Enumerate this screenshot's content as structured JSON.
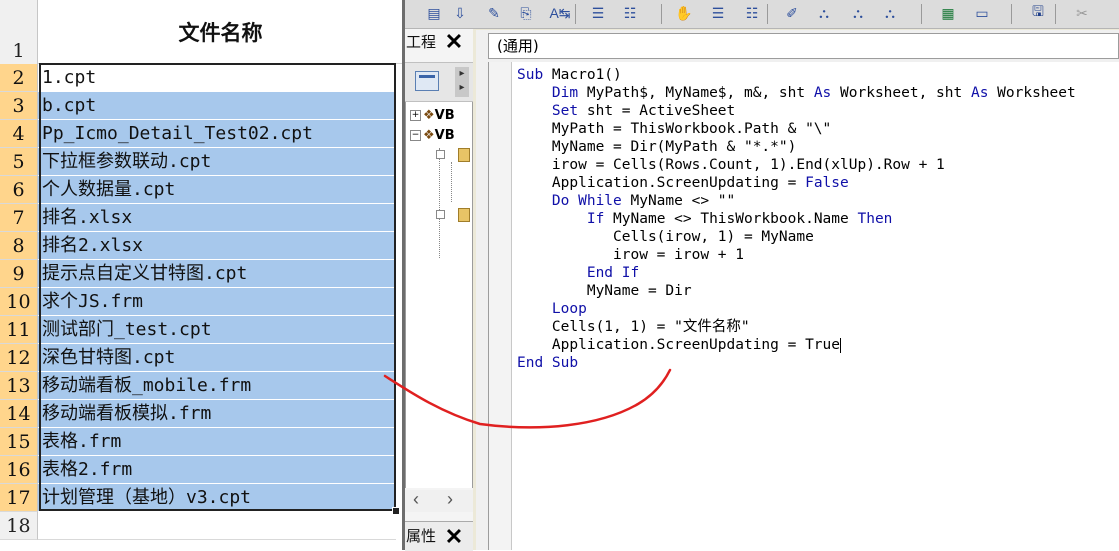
{
  "excel": {
    "header_row_number": "1",
    "header": "文件名称",
    "rows": [
      {
        "num": "2",
        "value": "1.cpt"
      },
      {
        "num": "3",
        "value": "b.cpt"
      },
      {
        "num": "4",
        "value": "Pp_Icmo_Detail_Test02.cpt"
      },
      {
        "num": "5",
        "value": "下拉框参数联动.cpt"
      },
      {
        "num": "6",
        "value": "个人数据量.cpt"
      },
      {
        "num": "7",
        "value": "排名.xlsx"
      },
      {
        "num": "8",
        "value": "排名2.xlsx"
      },
      {
        "num": "9",
        "value": "提示点自定义甘特图.cpt"
      },
      {
        "num": "10",
        "value": "求个JS.frm"
      },
      {
        "num": "11",
        "value": "测试部门_test.cpt"
      },
      {
        "num": "12",
        "value": "深色甘特图.cpt"
      },
      {
        "num": "13",
        "value": "移动端看板_mobile.frm"
      },
      {
        "num": "14",
        "value": "移动端看板模拟.frm"
      },
      {
        "num": "15",
        "value": "表格.frm"
      },
      {
        "num": "16",
        "value": "表格2.frm"
      },
      {
        "num": "17",
        "value": "计划管理（基地）v3.cpt"
      },
      {
        "num": "18",
        "value": ""
      }
    ],
    "selection_color": "#a7c8ec",
    "row_header_highlight": "#ffd58c"
  },
  "vbe": {
    "project_pane_title": "工程",
    "project_tree": [
      {
        "label": "VB",
        "expander": "+"
      },
      {
        "label": "VB",
        "expander": "−"
      }
    ],
    "properties_pane_title": "属性",
    "procedure_combo": "(通用)",
    "code_lines": [
      [
        {
          "t": "Sub",
          "k": true
        },
        {
          "t": " Macro1()"
        }
      ],
      [
        {
          "t": "    "
        },
        {
          "t": "Dim",
          "k": true
        },
        {
          "t": " MyPath$, MyName$, m&, sht "
        },
        {
          "t": "As",
          "k": true
        },
        {
          "t": " Worksheet, sht "
        },
        {
          "t": "As",
          "k": true
        },
        {
          "t": " Worksheet"
        }
      ],
      [
        {
          "t": "    "
        },
        {
          "t": "Set",
          "k": true
        },
        {
          "t": " sht = ActiveSheet"
        }
      ],
      [
        {
          "t": "    MyPath = ThisWorkbook.Path & \"\\\""
        }
      ],
      [
        {
          "t": "    MyName = Dir(MyPath & \"*.*\")"
        }
      ],
      [
        {
          "t": "    irow = Cells(Rows.Count, 1).End(xlUp).Row + 1"
        }
      ],
      [
        {
          "t": "    Application.ScreenUpdating = "
        },
        {
          "t": "False",
          "k": true
        }
      ],
      [
        {
          "t": "    "
        },
        {
          "t": "Do While",
          "k": true
        },
        {
          "t": " MyName <> \"\""
        }
      ],
      [
        {
          "t": "        "
        },
        {
          "t": "If",
          "k": true
        },
        {
          "t": " MyName <> ThisWorkbook.Name "
        },
        {
          "t": "Then",
          "k": true
        }
      ],
      [
        {
          "t": "           Cells(irow, 1) = MyName"
        }
      ],
      [
        {
          "t": "           irow = irow + 1"
        }
      ],
      [
        {
          "t": "        "
        },
        {
          "t": "End If",
          "k": true
        }
      ],
      [
        {
          "t": "        MyName = Dir"
        }
      ],
      [
        {
          "t": "    "
        },
        {
          "t": "Loop",
          "k": true
        }
      ],
      [
        {
          "t": "    Cells(1, 1) = \"文件名称\""
        }
      ],
      [
        {
          "t": "    Application.ScreenUpdating = True"
        },
        {
          "caret": true
        }
      ],
      [
        {
          "t": "End Sub",
          "k": true
        }
      ]
    ],
    "keyword_color": "#1010a8",
    "annotation_color": "#e02020"
  },
  "toolbar_icons": [
    "view-code-icon",
    "insert-module-icon",
    "find-icon",
    "undo-icon",
    "redo-icon",
    "indent-icon",
    "outdent-icon",
    "hand-icon",
    "toggle-breakpoint-icon",
    "comment-block-icon",
    "uncomment-icon",
    "bookmark-icon",
    "next-bookmark-icon",
    "prev-bookmark-icon",
    "excel-icon",
    "userform-icon",
    "save-icon",
    "cut-icon"
  ]
}
